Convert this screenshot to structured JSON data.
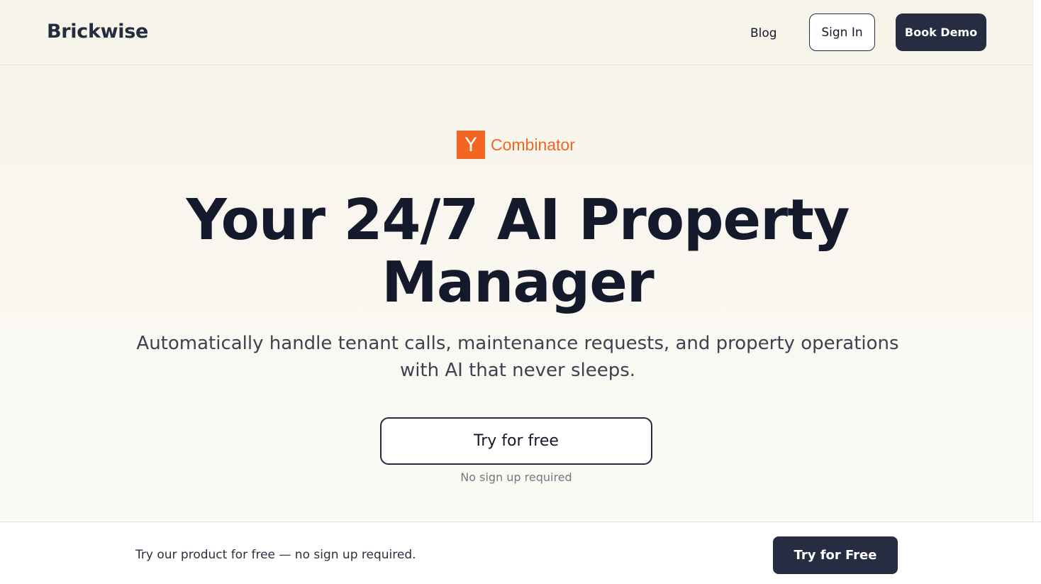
{
  "header": {
    "logo": "Brickwise",
    "nav": {
      "blog": "Blog"
    },
    "sign_in_label": "Sign In",
    "book_demo_label": "Book Demo"
  },
  "hero": {
    "badge": {
      "letter": "Y",
      "text": "Combinator",
      "color": "#f26522"
    },
    "headline_line1": "Your 24/7 AI Property",
    "headline_line2": "Manager",
    "subtitle_line1": "Automatically handle tenant calls, maintenance requests, and property operations",
    "subtitle_line2": "with AI that never sleeps.",
    "cta_label": "Try for free",
    "cta_note": "No sign up required"
  },
  "bottom_bar": {
    "text": "Try our product for free — no sign up required.",
    "cta_label": "Try for Free"
  },
  "colors": {
    "dark_button": "#262d42",
    "background": "#f7f3ea",
    "accent": "#f26522"
  }
}
